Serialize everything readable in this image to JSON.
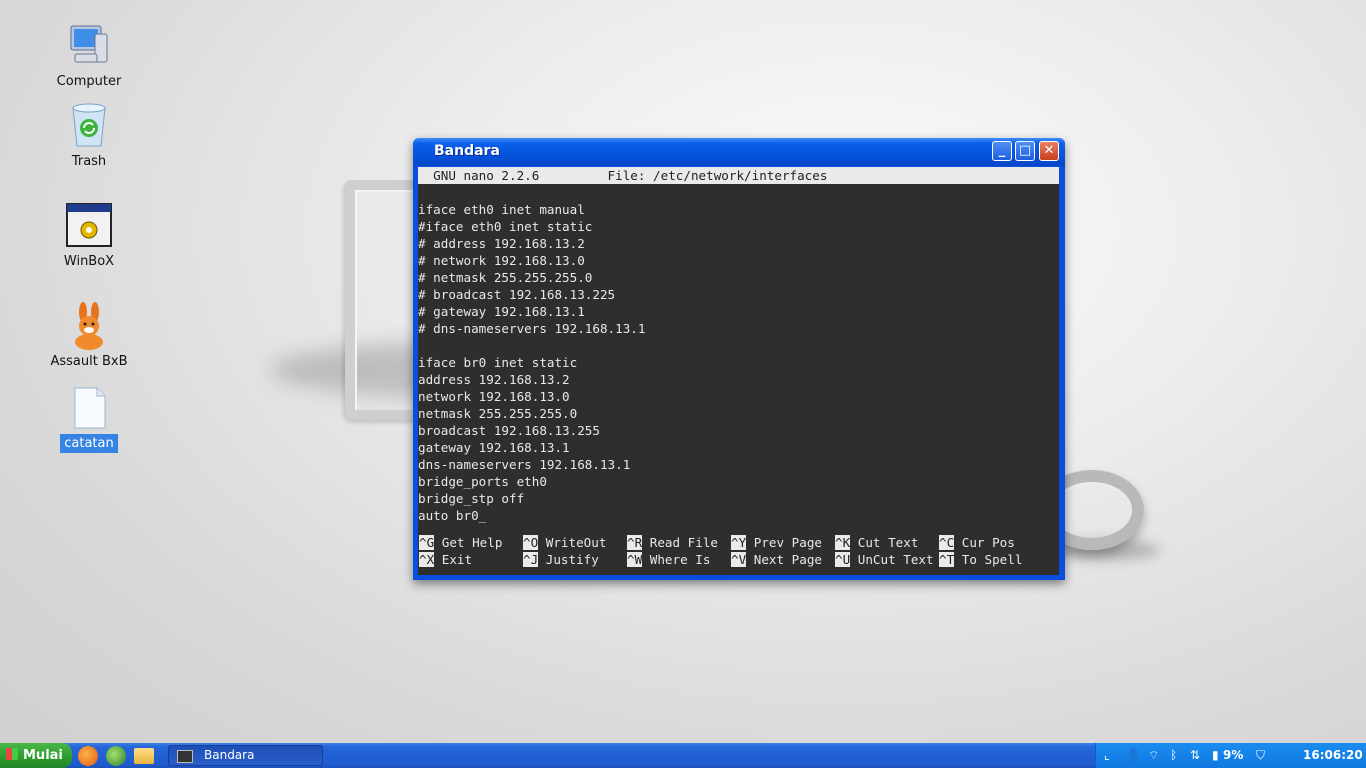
{
  "desktop": {
    "icons": [
      {
        "label": "Computer",
        "icon": "computer-icon",
        "selected": false
      },
      {
        "label": "Trash",
        "icon": "trash-icon",
        "selected": false
      },
      {
        "label": "WinBoX",
        "icon": "winbox-icon",
        "selected": false
      },
      {
        "label": "Assault BxB",
        "icon": "rabbit-icon",
        "selected": false
      },
      {
        "label": "catatan",
        "icon": "text-file-icon",
        "selected": true
      }
    ]
  },
  "window": {
    "title": "Bandara",
    "buttons": {
      "minimize": "minimize-icon",
      "maximize": "maximize-icon",
      "close": "close-icon"
    },
    "nano_header": "  GNU nano 2.2.6         File: /etc/network/interfaces",
    "lines": [
      "iface eth0 inet manual",
      "#iface eth0 inet static",
      "# address 192.168.13.2",
      "# network 192.168.13.0",
      "# netmask 255.255.255.0",
      "# broadcast 192.168.13.225",
      "# gateway 192.168.13.1",
      "# dns-nameservers 192.168.13.1",
      "",
      "iface br0 inet static",
      "address 192.168.13.2",
      "network 192.168.13.0",
      "netmask 255.255.255.0",
      "broadcast 192.168.13.255",
      "gateway 192.168.13.1",
      "dns-nameservers 192.168.13.1",
      "bridge_ports eth0",
      "bridge_stp off",
      "auto br0_"
    ],
    "shortcuts_row1": [
      {
        "key": "^G",
        "label": " Get Help"
      },
      {
        "key": "^O",
        "label": " WriteOut"
      },
      {
        "key": "^R",
        "label": " Read File"
      },
      {
        "key": "^Y",
        "label": " Prev Page"
      },
      {
        "key": "^K",
        "label": " Cut Text"
      },
      {
        "key": "^C",
        "label": " Cur Pos"
      }
    ],
    "shortcuts_row2": [
      {
        "key": "^X",
        "label": " Exit"
      },
      {
        "key": "^J",
        "label": " Justify"
      },
      {
        "key": "^W",
        "label": " Where Is"
      },
      {
        "key": "^V",
        "label": " Next Page"
      },
      {
        "key": "^U",
        "label": " UnCut Text"
      },
      {
        "key": "^T",
        "label": " To Spell"
      }
    ]
  },
  "taskbar": {
    "start_label": "Mulai",
    "quick_launch": [
      "firefox-icon",
      "globe-icon",
      "folder-icon"
    ],
    "task_label": "Bandara",
    "tray": {
      "battery": "9%",
      "clock": "16:06:20",
      "icons": [
        "show-desktop-icon",
        "user-icon",
        "wifi-icon",
        "bluetooth-icon",
        "network-icon",
        "battery-icon",
        "shield-icon"
      ]
    }
  }
}
